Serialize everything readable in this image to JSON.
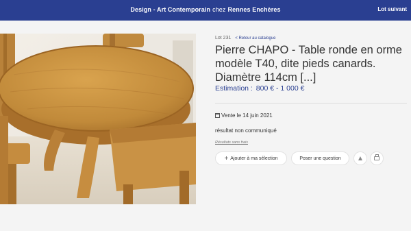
{
  "header": {
    "category": "Design - Art Contemporain",
    "chez": "chez",
    "house": "Rennes Enchères",
    "next_lot": "Lot suivant"
  },
  "lot": {
    "number": "Lot 231",
    "back_link": "< Retour au catalogue",
    "title": "Pierre CHAPO - Table ronde en orme modèle T40, dite pieds canards. Diamètre 114cm [...]",
    "estimate_label": "Estimation :",
    "estimate_value": "800 € - 1 000 €",
    "sale_date": "Vente le 14 juin 2021",
    "result": "résultat non communiqué",
    "fees_note": "Résultats sans frais"
  },
  "actions": {
    "add_selection": "Ajouter à ma sélection",
    "ask_question": "Poser une question"
  },
  "icons": {
    "calendar": "calendar-icon",
    "plus": "plus-icon",
    "alert": "bell-icon",
    "print": "printer-icon"
  },
  "colors": {
    "brand": "#2a3f91",
    "background": "#f4f4f4"
  }
}
